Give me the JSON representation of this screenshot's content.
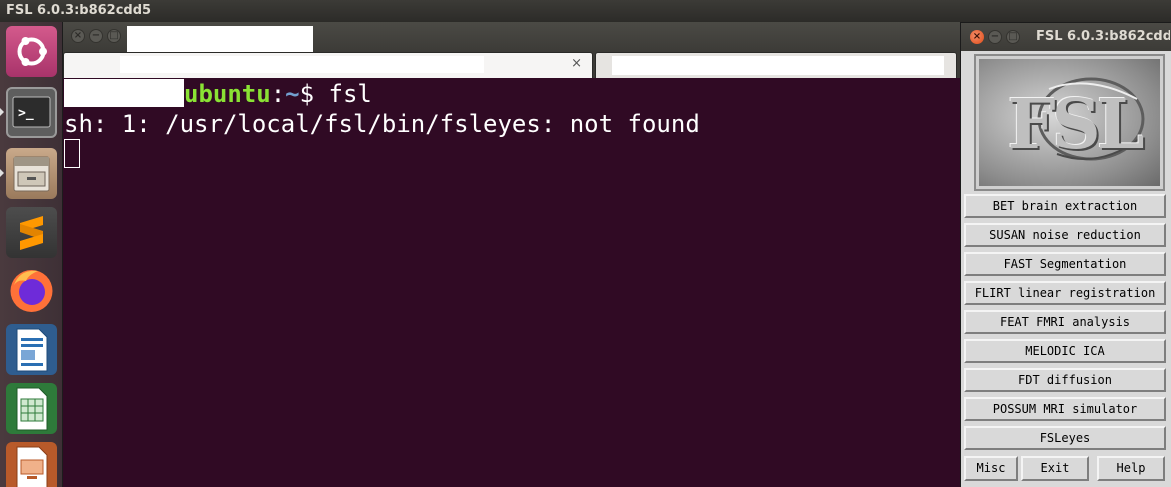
{
  "top_panel": {
    "title": "FSL 6.0.3:b862cdd5"
  },
  "launcher": {
    "items": [
      {
        "name": "ubuntu-dash",
        "icon": "ubuntu-logo-icon"
      },
      {
        "name": "terminal",
        "icon": "terminal-icon",
        "glyph": ">_"
      },
      {
        "name": "files",
        "icon": "file-cabinet-icon"
      },
      {
        "name": "sublime-text",
        "icon": "sublime-text-icon"
      },
      {
        "name": "firefox",
        "icon": "firefox-icon"
      },
      {
        "name": "libreoffice-writer",
        "icon": "writer-document-icon"
      },
      {
        "name": "libreoffice-calc",
        "icon": "calc-spreadsheet-icon"
      },
      {
        "name": "libreoffice-impress",
        "icon": "impress-presentation-icon"
      }
    ]
  },
  "terminal": {
    "tab_close_glyph": "×",
    "prompt_host": "ubuntu",
    "prompt_sep": ":",
    "prompt_path": "~",
    "prompt_symbol": "$ ",
    "command": "fsl",
    "output_line": "sh: 1: /usr/local/fsl/bin/fsleyes: not found",
    "background_color": "#300a24"
  },
  "fsl_window": {
    "title": "FSL 6.0.3:b862cdd5",
    "logo_text": "FSL",
    "buttons": [
      "BET brain extraction",
      "SUSAN noise reduction",
      "FAST Segmentation",
      "FLIRT linear registration",
      "FEAT FMRI analysis",
      "MELODIC ICA",
      "FDT diffusion",
      "POSSUM MRI simulator",
      "FSLeyes"
    ],
    "bottom_buttons": {
      "misc": "Misc",
      "exit": "Exit",
      "help": "Help"
    }
  }
}
